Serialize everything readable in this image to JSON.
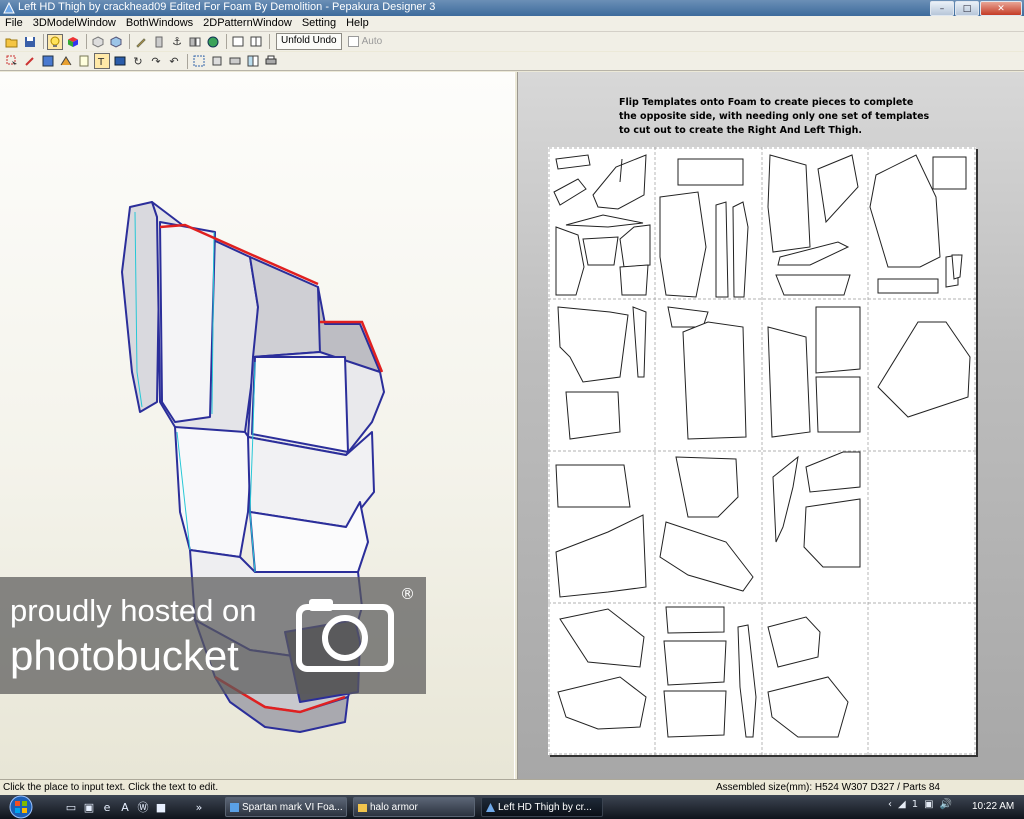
{
  "window": {
    "title": "Left HD Thigh by crackhead09 Edited For Foam By Demolition - Pepakura Designer 3",
    "buttons": {
      "minimize": "–",
      "maximize": "□",
      "close": "✕"
    }
  },
  "menu": {
    "items": [
      "File",
      "3DModelWindow",
      "BothWindows",
      "2DPatternWindow",
      "Setting",
      "Help"
    ]
  },
  "toolbar1": {
    "icons": [
      "open-icon",
      "save-icon",
      "lightbulb-icon",
      "color-cube-icon",
      "box-icon",
      "box-texture-icon",
      "pencil-icon",
      "column-icon",
      "anchor-icon",
      "split-icon",
      "globe-icon",
      "single-window-icon",
      "double-window-icon"
    ],
    "unfold_undo_label": "Unfold Undo",
    "auto_label": "Auto"
  },
  "toolbar2": {
    "icons": [
      "select-icon",
      "edit-icon",
      "grid-icon",
      "fold-icon",
      "paper-icon",
      "text-tool-icon",
      "image-icon",
      "rotate-icon",
      "redo-icon",
      "undo-icon",
      "arrange-icon",
      "move-icon",
      "print-icon",
      "layout-icon",
      "printer-icon"
    ]
  },
  "pattern": {
    "note_line1": "Flip Templates onto Foam to create pieces to complete",
    "note_line2": "the opposite side, with needing only one set of templates",
    "note_line3": "to cut out to create the Right And Left  Thigh."
  },
  "watermark": {
    "line1": "proudly hosted on",
    "line2": "photobucket",
    "reg": "®"
  },
  "status": {
    "left": "Click the place to input text. Click the text to edit.",
    "right": "Assembled size(mm): H524 W307 D327 / Parts 84"
  },
  "taskbar": {
    "tasks": [
      {
        "label": "Spartan mark VI Foa...",
        "active": false
      },
      {
        "label": "halo armor",
        "active": false
      },
      {
        "label": "Left HD Thigh by cr...",
        "active": true
      }
    ],
    "clock": "10:22 AM",
    "tray_icons": [
      "chevron-left-icon",
      "network-icon",
      "language-icon",
      "display-icon",
      "volume-icon"
    ]
  }
}
